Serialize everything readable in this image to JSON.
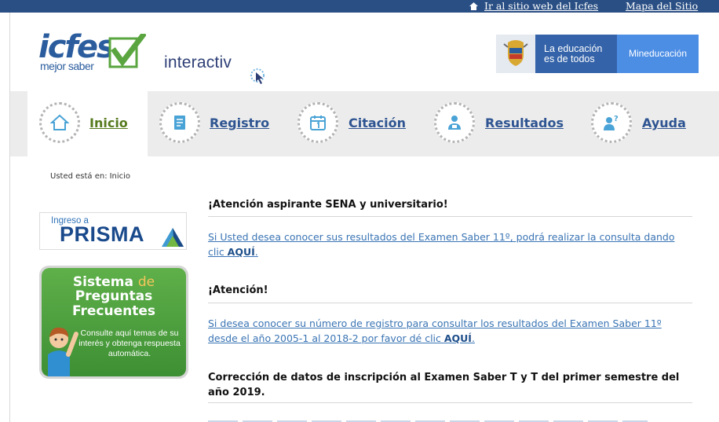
{
  "topbar": {
    "site_link": "Ir al sitio web del Icfes",
    "sitemap_link": "Mapa del Sitio"
  },
  "header": {
    "logo_main": "icfes",
    "logo_sub": "mejor saber",
    "logo_product": "interactiv",
    "gov_educ_line1": "La educación",
    "gov_educ_line2": "es de todos",
    "gov_ministry": "Mineducación"
  },
  "nav": {
    "items": [
      {
        "label": "Inicio",
        "icon": "home-icon",
        "active": true
      },
      {
        "label": "Registro",
        "icon": "form-icon",
        "active": false
      },
      {
        "label": "Citación",
        "icon": "calendar-icon",
        "active": false
      },
      {
        "label": "Resultados",
        "icon": "person-icon",
        "active": false
      },
      {
        "label": "Ayuda",
        "icon": "help-icon",
        "active": false
      }
    ]
  },
  "breadcrumb": {
    "prefix": "Usted está en:",
    "current": "Inicio"
  },
  "sidebar": {
    "prisma_pre": "Ingreso a",
    "prisma_name": "PRISMA",
    "faq_line1": "Sistema",
    "faq_line1b": "de",
    "faq_line2": "Preguntas",
    "faq_line3": "Frecuentes",
    "faq_desc": "Consulte aquí temas de su interés y obtenga respuesta automática."
  },
  "notices": [
    {
      "title": "¡Atención aspirante SENA y universitario!",
      "text": "Si Usted desea conocer sus resultados del Examen Saber 11º, podrá realizar la consulta dando clic ",
      "link": "AQUÍ",
      "end": "."
    },
    {
      "title": "¡Atención!",
      "text": "Si desea conocer su número de registro para consultar los resultados del Examen Saber 11º desde el año 2005-1 al 2018-2 por favor dé clic ",
      "link": "AQUÍ",
      "end": "."
    },
    {
      "title": "Corrección de datos de inscripción al Examen Saber T y T del primer semestre del año 2019."
    }
  ],
  "colors": {
    "topbar": "#2a4f84",
    "nav_link": "#2e5491",
    "active_link": "#567a1e",
    "body_link": "#3a74b4"
  }
}
